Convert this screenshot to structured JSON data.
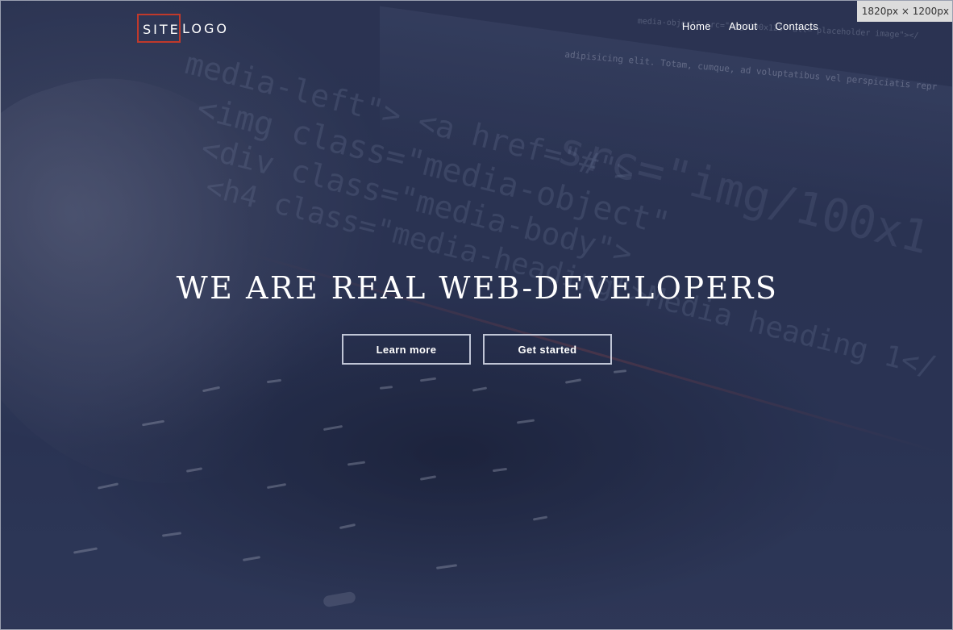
{
  "logo": {
    "site": "SITE",
    "rest": "LOGO"
  },
  "nav": {
    "items": [
      "Home",
      "About",
      "Contacts"
    ]
  },
  "hero": {
    "headline": "WE ARE REAL WEB-DEVELOPERS",
    "learn_more": "Learn more",
    "get_started": "Get started",
    "code_lines": [
      "media-left\"> <a href=\"#\">",
      "<img class=\"media-object\"",
      "<div class=\"media-body\">",
      "<h4 class=\"media-heading\">Media heading 1</",
      "adipisicing elit. Totam, cumque, ad voluptatibus vel perspiciatis repr",
      "media-object\" src=\"img/100x125\" alt=\"placeholder image\"></",
      "src=\"img/100x1"
    ]
  },
  "devtools": {
    "dimensions": "1820px × 1200px"
  },
  "colors": {
    "logo_border": "#c0392b",
    "overlay": "#2c3553",
    "text": "#ffffff"
  }
}
